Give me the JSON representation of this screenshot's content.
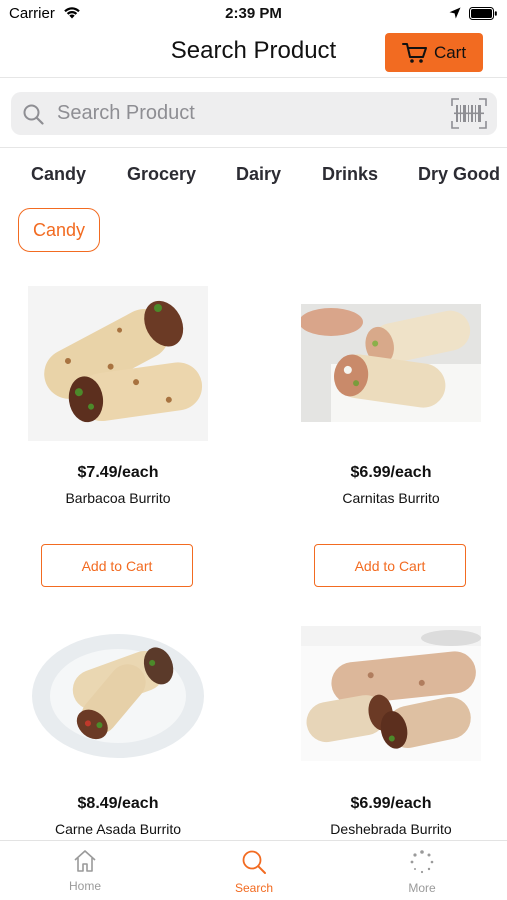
{
  "status_bar": {
    "carrier": "Carrier",
    "time": "2:39 PM"
  },
  "header": {
    "title": "Search Product",
    "cart_label": "Cart"
  },
  "search": {
    "placeholder": "Search Product"
  },
  "categories": [
    "Candy",
    "Grocery",
    "Dairy",
    "Drinks",
    "Dry Good"
  ],
  "selected_chip": "Candy",
  "products": [
    {
      "price": "$7.49/each",
      "name": "Barbacoa Burrito",
      "button": "Add to Cart"
    },
    {
      "price": "$6.99/each",
      "name": "Carnitas Burrito",
      "button": "Add to Cart"
    },
    {
      "price": "$8.49/each",
      "name": "Carne Asada Burrito"
    },
    {
      "price": "$6.99/each",
      "name": "Deshebrada Burrito"
    }
  ],
  "tab_bar": [
    {
      "label": "Home",
      "icon": "home-icon",
      "active": false
    },
    {
      "label": "Search",
      "icon": "search-icon",
      "active": true
    },
    {
      "label": "More",
      "icon": "more-icon",
      "active": false
    }
  ],
  "colors": {
    "accent": "#f26b21",
    "search_bg": "#eeeeef",
    "inactive_tab": "#9a9a9a"
  }
}
